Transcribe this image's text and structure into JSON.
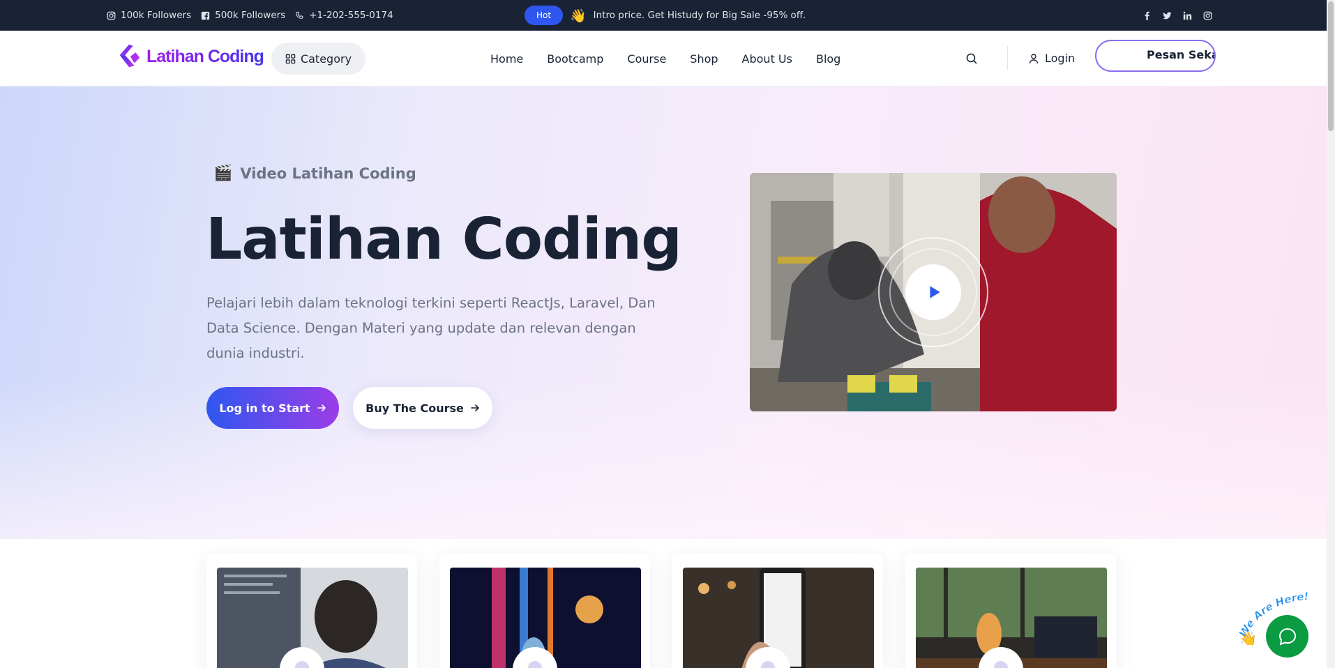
{
  "topbar": {
    "instagram_followers": "100k Followers",
    "facebook_followers": "500k Followers",
    "phone": "+1-202-555-0174",
    "hot_badge": "Hot",
    "promo_emoji": "👋",
    "promo_text": "Intro price. Get Histudy for Big Sale -95% off.",
    "social_icons": [
      "facebook-icon",
      "twitter-icon",
      "linkedin-icon",
      "instagram-icon"
    ]
  },
  "header": {
    "logo_text": "Latihan Coding",
    "category_label": "Category",
    "nav": [
      "Home",
      "Bootcamp",
      "Course",
      "Shop",
      "About Us",
      "Blog"
    ],
    "login_label": "Login",
    "cta_label": "Pesan Sekarang"
  },
  "hero": {
    "subtitle_emoji": "🎬",
    "subtitle": "Video Latihan Coding",
    "title": "Latihan Coding",
    "description": "Pelajari lebih dalam teknologi terkini seperti ReactJs, Laravel, Dan Data Science. Dengan Materi yang update dan relevan dengan dunia industri.",
    "primary_button": "Log in to Start",
    "secondary_button": "Buy The Course"
  },
  "widgets": {
    "chat_label": "We Are Here!"
  },
  "colors": {
    "topbar_bg": "#192335",
    "accent": "#2f57ef",
    "accent_purple": "#9b3de8",
    "chat_green": "#0b9b43"
  }
}
